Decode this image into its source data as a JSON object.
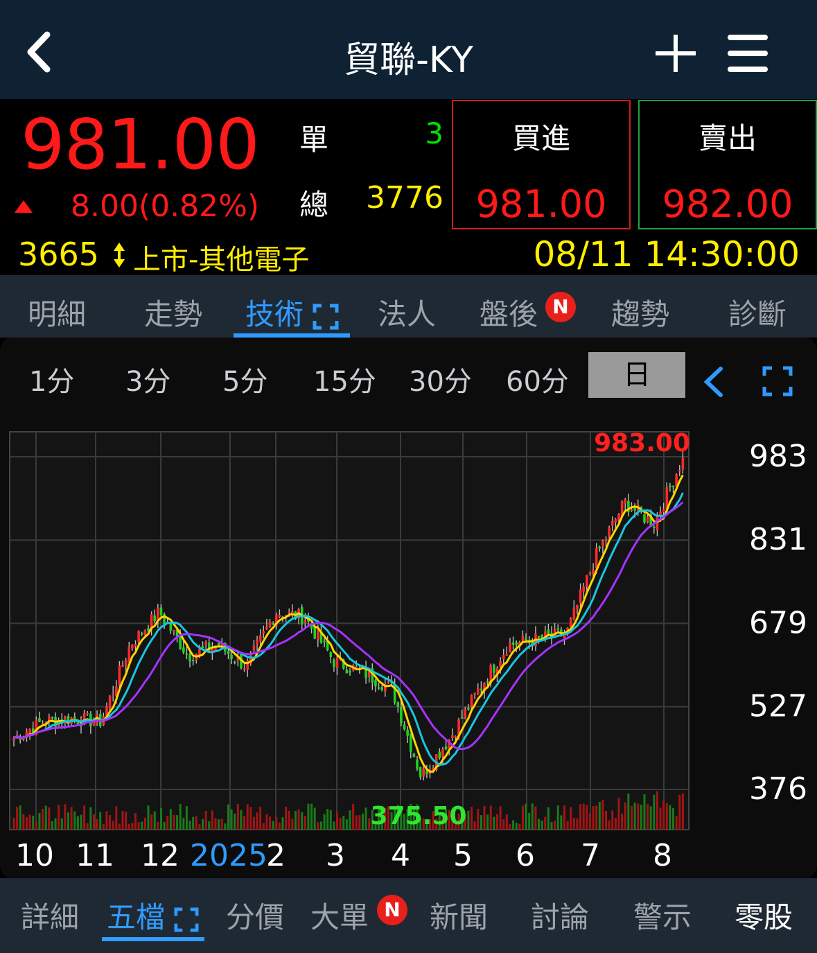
{
  "header": {
    "title": "貿聯-KY"
  },
  "quote": {
    "price": "981.00",
    "change": "8.00",
    "change_pct": "(0.82%)",
    "single_label": "單",
    "single_value": "3",
    "total_label": "總",
    "total_value": "3776",
    "buy_label": "買進",
    "buy_price": "981.00",
    "sell_label": "賣出",
    "sell_price": "982.00",
    "code": "3665",
    "market": "上市-其他電子",
    "time": "08/11 14:30:00",
    "up_color": "#ff1a1a",
    "down_color": "#00e000"
  },
  "tabs": [
    {
      "label": "明細"
    },
    {
      "label": "走勢"
    },
    {
      "label": "技術",
      "active": true
    },
    {
      "label": "法人"
    },
    {
      "label": "盤後",
      "badge": "N"
    },
    {
      "label": "趨勢"
    },
    {
      "label": "診斷"
    }
  ],
  "intervals": [
    "1分",
    "3分",
    "5分",
    "15分",
    "30分",
    "60分",
    "日"
  ],
  "chart_data": {
    "type": "candlestick",
    "period": "日",
    "y_ticks": [
      "983",
      "831",
      "679",
      "527",
      "376"
    ],
    "ylim": [
      376,
      983
    ],
    "x_ticks": [
      "10",
      "11",
      "12",
      "2025",
      "2",
      "3",
      "4",
      "5",
      "6",
      "7",
      "8"
    ],
    "high_label": "983.00",
    "low_label": "375.50",
    "close_path_approx": [
      {
        "m": "10",
        "v": 470
      },
      {
        "m": "10",
        "v": 500
      },
      {
        "m": "11",
        "v": 505
      },
      {
        "m": "11",
        "v": 500
      },
      {
        "m": "12",
        "v": 640
      },
      {
        "m": "12",
        "v": 700
      },
      {
        "m": "12",
        "v": 620
      },
      {
        "m": "2025",
        "v": 640
      },
      {
        "m": "2025",
        "v": 600
      },
      {
        "m": "2",
        "v": 700
      },
      {
        "m": "2",
        "v": 690
      },
      {
        "m": "3",
        "v": 610
      },
      {
        "m": "3",
        "v": 590
      },
      {
        "m": "4",
        "v": 560
      },
      {
        "m": "4",
        "v": 400
      },
      {
        "m": "4",
        "v": 470
      },
      {
        "m": "5",
        "v": 560
      },
      {
        "m": "5",
        "v": 640
      },
      {
        "m": "6",
        "v": 650
      },
      {
        "m": "6",
        "v": 660
      },
      {
        "m": "7",
        "v": 800
      },
      {
        "m": "7",
        "v": 900
      },
      {
        "m": "8",
        "v": 860
      },
      {
        "m": "8",
        "v": 981
      }
    ],
    "ma_colors": [
      "#ffd400",
      "#19c6e0",
      "#a533ff"
    ],
    "grid": true
  },
  "bottom_tabs": [
    {
      "label": "詳細"
    },
    {
      "label": "五檔",
      "active": true
    },
    {
      "label": "分價"
    },
    {
      "label": "大單",
      "badge": "N"
    },
    {
      "label": "新聞"
    },
    {
      "label": "討論"
    },
    {
      "label": "警示"
    },
    {
      "label": "零股"
    }
  ]
}
